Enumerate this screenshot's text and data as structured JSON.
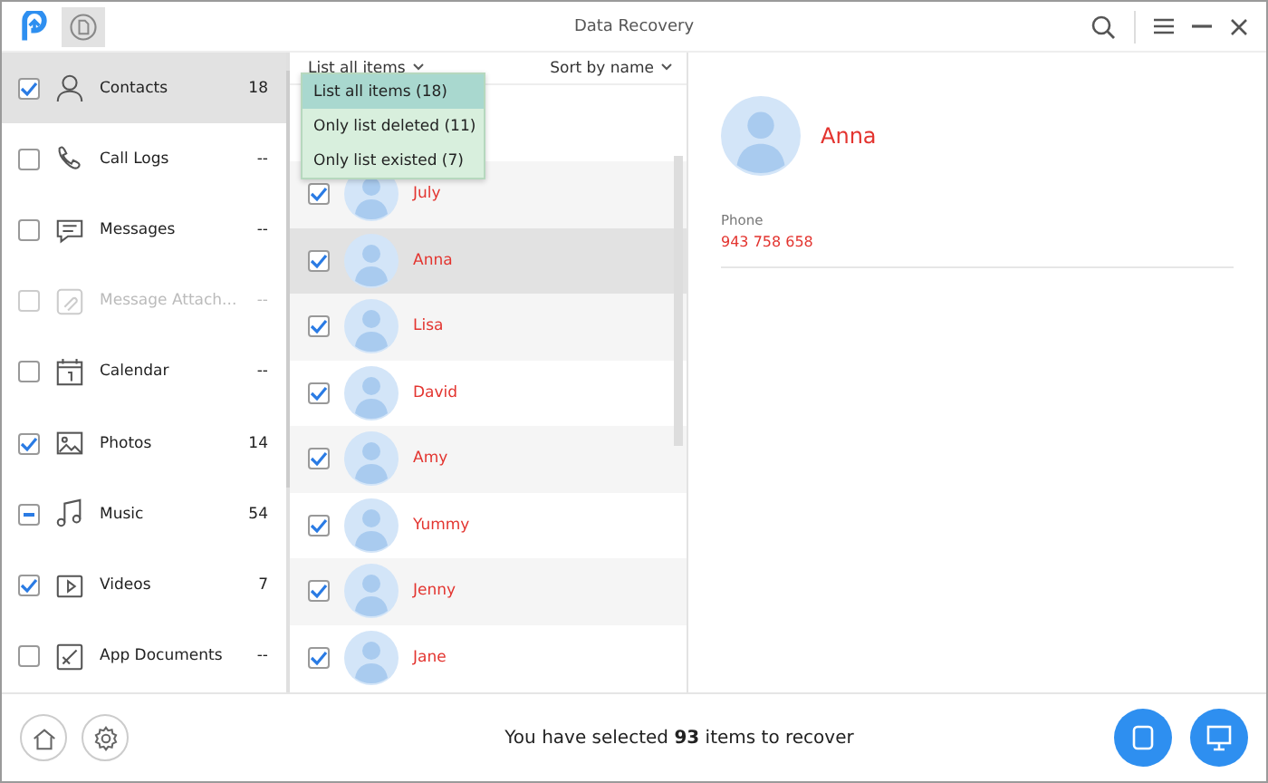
{
  "window": {
    "title": "Data Recovery"
  },
  "sidebar": {
    "items": [
      {
        "label": "Contacts",
        "count": "18",
        "checked": true,
        "selected": true,
        "disabled": false
      },
      {
        "label": "Call Logs",
        "count": "--",
        "checked": false,
        "selected": false,
        "disabled": false
      },
      {
        "label": "Messages",
        "count": "--",
        "checked": false,
        "selected": false,
        "disabled": false
      },
      {
        "label": "Message Attach...",
        "count": "--",
        "checked": false,
        "selected": false,
        "disabled": true
      },
      {
        "label": "Calendar",
        "count": "--",
        "checked": false,
        "selected": false,
        "disabled": false
      },
      {
        "label": "Photos",
        "count": "14",
        "checked": true,
        "selected": false,
        "disabled": false
      },
      {
        "label": "Music",
        "count": "54",
        "checked": true,
        "partial": true,
        "selected": false,
        "disabled": false
      },
      {
        "label": "Videos",
        "count": "7",
        "checked": true,
        "selected": false,
        "disabled": false
      },
      {
        "label": "App Documents",
        "count": "--",
        "checked": false,
        "selected": false,
        "disabled": false
      }
    ]
  },
  "list": {
    "filter": "List all items",
    "sort": "Sort by name",
    "filter_menu": [
      {
        "label": "List all items (18)",
        "selected": true
      },
      {
        "label": "Only list deleted (11)",
        "selected": false
      },
      {
        "label": "Only list existed (7)",
        "selected": false
      }
    ],
    "rows": [
      {
        "name": "July",
        "checked": true,
        "selected": false
      },
      {
        "name": "Anna",
        "checked": true,
        "selected": true
      },
      {
        "name": "Lisa",
        "checked": true,
        "selected": false
      },
      {
        "name": "David",
        "checked": true,
        "selected": false
      },
      {
        "name": "Amy",
        "checked": true,
        "selected": false
      },
      {
        "name": "Yummy",
        "checked": true,
        "selected": false
      },
      {
        "name": "Jenny",
        "checked": true,
        "selected": false
      },
      {
        "name": "Jane",
        "checked": true,
        "selected": false
      }
    ]
  },
  "detail": {
    "name": "Anna",
    "fields": [
      {
        "label": "Phone",
        "value": "943 758 658"
      }
    ]
  },
  "status": "You have selected **93** items to recover"
}
